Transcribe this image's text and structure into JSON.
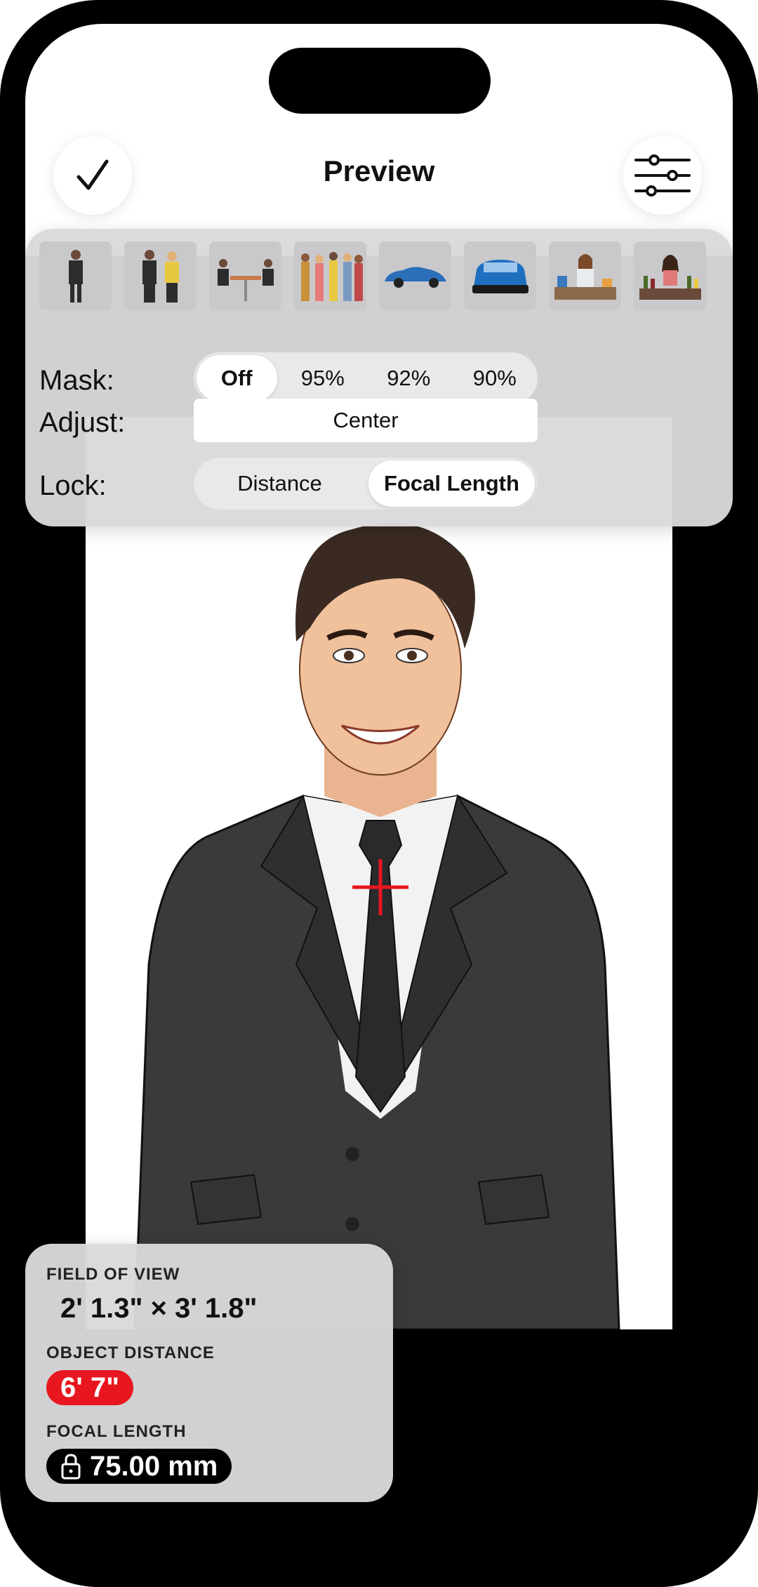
{
  "nav": {
    "title": "Preview",
    "done_icon": "checkmark-icon",
    "settings_icon": "sliders-icon"
  },
  "thumbnails": [
    {
      "name": "single-man"
    },
    {
      "name": "couple"
    },
    {
      "name": "meeting-table"
    },
    {
      "name": "group"
    },
    {
      "name": "car-side"
    },
    {
      "name": "car-front"
    },
    {
      "name": "woman-desk"
    },
    {
      "name": "woman-bottles"
    }
  ],
  "mask": {
    "label": "Mask:",
    "options": [
      "Off",
      "95%",
      "92%",
      "90%"
    ],
    "selected": "Off"
  },
  "adjust": {
    "label": "Adjust:",
    "value": "Center"
  },
  "lock": {
    "label": "Lock:",
    "options": [
      "Distance",
      "Focal Length"
    ],
    "selected": "Focal Length"
  },
  "info": {
    "fov_label": "FIELD OF VIEW",
    "fov_value": "2' 1.3\" × 3' 1.8\"",
    "distance_label": "OBJECT DISTANCE",
    "distance_value": "6' 7\"",
    "focal_label": "FOCAL LENGTH",
    "focal_value": "75.00 mm",
    "lock_icon": "lock-icon"
  },
  "colors": {
    "accent_red": "#e8161f",
    "panel_gray": "#dadadc"
  }
}
